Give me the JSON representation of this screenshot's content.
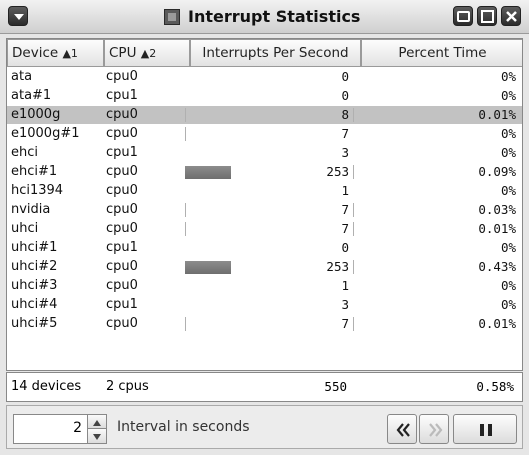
{
  "window": {
    "title": "Interrupt Statistics"
  },
  "columns": [
    {
      "label": "Device",
      "sort": "▲1"
    },
    {
      "label": "CPU",
      "sort": "▲2"
    },
    {
      "label": "Interrupts Per Second"
    },
    {
      "label": "Percent Time"
    }
  ],
  "rows": [
    {
      "device": "ata",
      "cpu": "cpu0",
      "ips": "0",
      "pct": "0%",
      "bar": 0,
      "tick": false
    },
    {
      "device": "ata#1",
      "cpu": "cpu1",
      "ips": "0",
      "pct": "0%",
      "bar": 0,
      "tick": false
    },
    {
      "device": "e1000g",
      "cpu": "cpu0",
      "ips": "8",
      "pct": "0.01%",
      "bar": 0.01,
      "tick": true,
      "selected": true
    },
    {
      "device": "e1000g#1",
      "cpu": "cpu0",
      "ips": "7",
      "pct": "0%",
      "bar": 0.01,
      "tick": false
    },
    {
      "device": "ehci",
      "cpu": "cpu1",
      "ips": "3",
      "pct": "0%",
      "bar": 0,
      "tick": false
    },
    {
      "device": "ehci#1",
      "cpu": "cpu0",
      "ips": "253",
      "pct": "0.09%",
      "bar": 0.46,
      "tick": true
    },
    {
      "device": "hci1394",
      "cpu": "cpu0",
      "ips": "1",
      "pct": "0%",
      "bar": 0,
      "tick": false
    },
    {
      "device": "nvidia",
      "cpu": "cpu0",
      "ips": "7",
      "pct": "0.03%",
      "bar": 0.01,
      "tick": true
    },
    {
      "device": "uhci",
      "cpu": "cpu0",
      "ips": "7",
      "pct": "0.01%",
      "bar": 0.01,
      "tick": true
    },
    {
      "device": "uhci#1",
      "cpu": "cpu1",
      "ips": "0",
      "pct": "0%",
      "bar": 0,
      "tick": false
    },
    {
      "device": "uhci#2",
      "cpu": "cpu0",
      "ips": "253",
      "pct": "0.43%",
      "bar": 0.46,
      "tick": true
    },
    {
      "device": "uhci#3",
      "cpu": "cpu0",
      "ips": "1",
      "pct": "0%",
      "bar": 0,
      "tick": false
    },
    {
      "device": "uhci#4",
      "cpu": "cpu1",
      "ips": "3",
      "pct": "0%",
      "bar": 0,
      "tick": false
    },
    {
      "device": "uhci#5",
      "cpu": "cpu0",
      "ips": "7",
      "pct": "0.01%",
      "bar": 0.01,
      "tick": true
    }
  ],
  "summary": {
    "devices": "14 devices",
    "cpus": "2 cpus",
    "ips": "550",
    "pct": "0.58%"
  },
  "controls": {
    "interval_value": "2",
    "interval_label": "Interval in seconds",
    "back_icon": "double-chevron-left-icon",
    "forward_icon": "double-chevron-right-icon",
    "pause_icon": "pause-icon"
  },
  "colors": {
    "selected_row": "#c2c2c2",
    "bar": "#7a7a7a"
  }
}
